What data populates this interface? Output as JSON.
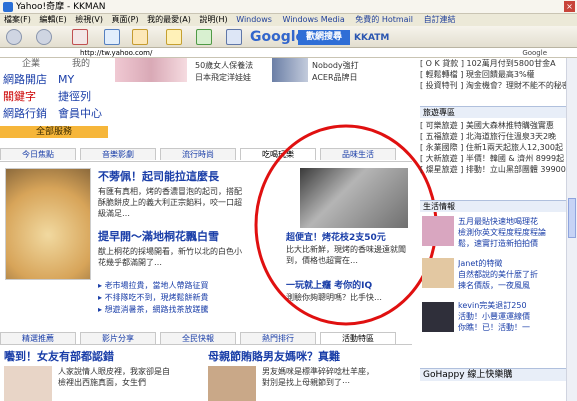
{
  "window": {
    "title": "Yahoo!奇摩 - KKMAN"
  },
  "menu": {
    "items": [
      "檔案(F)",
      "編輯(E)",
      "檢視(V)",
      "頁面(P)",
      "我的最愛(A)",
      "說明(H)"
    ],
    "links": [
      "Windows",
      "Windows Media",
      "免費的 Hotmail",
      "自訂連結"
    ]
  },
  "toolbar": {
    "google": "Google",
    "search_btn": "歡網搜尋",
    "kkatm": "KKATM"
  },
  "address": {
    "url": "http://tw.yahoo.com/",
    "right": "Google"
  },
  "left_services": {
    "items": [
      "網路開店",
      "關鍵字",
      "網路行銷"
    ],
    "items2": [
      "MY",
      "捷徑列",
      "會員中心"
    ],
    "all_services": "全部服務",
    "top_cut": [
      "企業",
      "我的"
    ]
  },
  "top_ads": {
    "col1": [
      "50歲女人保養法",
      "日本飛定洋娃娃"
    ],
    "col2": [
      "Nobody強打",
      "ACER品牌日"
    ]
  },
  "tabs": {
    "main": [
      "今日焦點",
      "音樂影劇",
      "流行時尚",
      "吃喝玩樂",
      "品味生活"
    ],
    "bottom": [
      "精選推薦",
      "影片分享",
      "全民快報",
      "熱門排行",
      "活動特區"
    ]
  },
  "feature": {
    "title1": "不蒡佩！起司能拉這麼長",
    "desc1": "有匯有真相，烤的香濃冒泡的起司，搭配酥脆餅皮上的義大利正宗餡料，咬一口超級滿足…",
    "title2": "提早開～滿地桐花飄白雪",
    "desc2": "猷上桐花的採場開看，新竹以北的白色小花幾乎都滿開了…",
    "links": [
      "老市場拉貴，當地人帶路征買",
      "不排隊吃不到，現烤鬆餅新貴",
      "想遊消暑茶，網路找茶放蹉騰"
    ]
  },
  "side_feature": {
    "title1": "超便宜！烤花枝2支50元",
    "desc1": "比大比新鮮，現烤的香味邊遠就聞到，價格也超實在…",
    "title2": "一玩就上癮 考你的IQ",
    "desc2": "測驗你夠聰明嗎？比手快…"
  },
  "bottom_news": {
    "left": "囈到！女友有部都認錯",
    "left_desc": [
      "人家說情人眼皮裡，我家卻是自",
      "檢裡出西施真面，女生們"
    ],
    "right": "母親節賄賂男友媽咪？真難",
    "right_desc": [
      "男友媽咪是標準碎碎唸杜羊座，",
      "對別是找上母親節到了⋯"
    ]
  },
  "right_panel": {
    "top": [
      "[ O K 貸款 ] 102萬月付到5800甘金A",
      "[ 輕鬆轉檔 ] 現金回饋最高3%權",
      "[ 投資特刊 ] 淘金機會？理財不能不的秘密"
    ],
    "travel_title": "旅遊專區",
    "travel": [
      "[ 可樂旅遊 ] 美國大森林推特購強實惠",
      "[ 五福旅遊 ] 北海道旅行住溫泉3天2晚",
      "[ 永業國際 ] 住新1兩天起旅人12,300起",
      "[ 大新旅遊 ] 半價！韓國 & 濟州 8999起",
      "[ 燦星旅遊 ] 排動！立山黑部團體 39900起"
    ],
    "life_title": "生活情報",
    "life": [
      "五月最貼快速地喝理花",
      "檢測你英文程度程度程論",
      "鬆，速實打造新拍拍價",
      "Janet的特徵",
      "自然都說的美什麼了折",
      "揀名價版，一夜風風",
      "kevin完美退訂250",
      "活動！小豐運運線價",
      "你瞧！已！活動！一"
    ],
    "gohappy": "GoHappy 線上快樂購"
  }
}
